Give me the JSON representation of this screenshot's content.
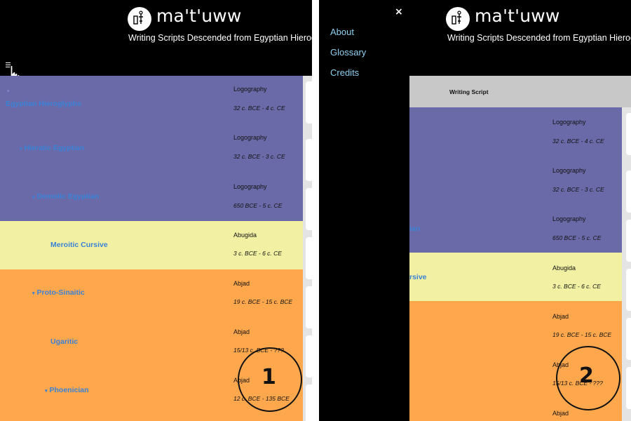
{
  "app": {
    "name": "ma't'uww",
    "tagline": "Writing Scripts Descended from Egyptian Hieroglyphs"
  },
  "menu": {
    "items": [
      "About",
      "Glossary",
      "Credits"
    ],
    "close_symbol": "×"
  },
  "table": {
    "column_header": "Writing Script"
  },
  "scripts": [
    {
      "name": "Egyptian Hieroglyphs",
      "type": "Logography",
      "dates": "32 c. BCE - 4 c. CE",
      "family": "purple"
    },
    {
      "name": "Hieratic Egyptian",
      "type": "Logography",
      "dates": "32 c. BCE - 3 c. CE",
      "family": "purple"
    },
    {
      "name": "Demotic Egyptian",
      "type": "Logography",
      "dates": "650 BCE - 5 c. CE",
      "family": "purple"
    },
    {
      "name": "Meroitic Cursive",
      "type": "Abugida",
      "dates": "3 c. BCE - 6 c. CE",
      "family": "yellow"
    },
    {
      "name": "Proto-Sinaitic",
      "type": "Abjad",
      "dates": "19 c. BCE - 15 c. BCE",
      "family": "orange"
    },
    {
      "name": "Ugaritic",
      "type": "Abjad",
      "dates": "15/13 c. BCE - ???",
      "family": "orange"
    },
    {
      "name": "Phoenician",
      "type": "Abjad",
      "dates": "12 c. BCE - 135 BCE",
      "family": "orange"
    }
  ],
  "partial_names": {
    "demotic": "ian",
    "meroitic": "rsive"
  },
  "annotations": {
    "step1": "1",
    "step2": "2"
  },
  "colors": {
    "purple": "#6a6aa8",
    "yellow": "#f1f0a3",
    "orange": "#ffa74d",
    "link": "#3b82d6",
    "menu_link": "#8fd0f0"
  },
  "icons": [
    "logo-icon",
    "hamburger-menu-icon",
    "pointer-hand-icon",
    "close-icon",
    "expand-arrow-icon"
  ]
}
